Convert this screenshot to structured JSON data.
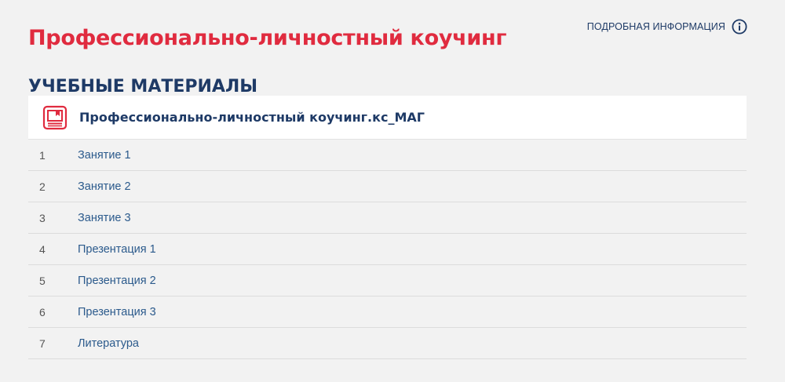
{
  "header": {
    "title": "Профессионально-личностный коучинг",
    "info_link_label": "ПОДРОБНАЯ ИНФОРМАЦИЯ",
    "info_icon": "info-circle-icon"
  },
  "section": {
    "heading": "УЧЕБНЫЕ МАТЕРИАЛЫ"
  },
  "course": {
    "icon": "book-icon",
    "title": "Профессионально-личностный коучинг.кс_МАГ"
  },
  "materials": [
    {
      "number": "1",
      "label": "Занятие 1"
    },
    {
      "number": "2",
      "label": "Занятие 2"
    },
    {
      "number": "3",
      "label": "Занятие 3"
    },
    {
      "number": "4",
      "label": "Презентация 1"
    },
    {
      "number": "5",
      "label": "Презентация 2"
    },
    {
      "number": "6",
      "label": "Презентация 3"
    },
    {
      "number": "7",
      "label": "Литература"
    }
  ],
  "colors": {
    "accent_red": "#e02b3f",
    "brand_navy": "#1e3a66",
    "link_blue": "#2b5a8c",
    "background": "#f2f2f2"
  }
}
